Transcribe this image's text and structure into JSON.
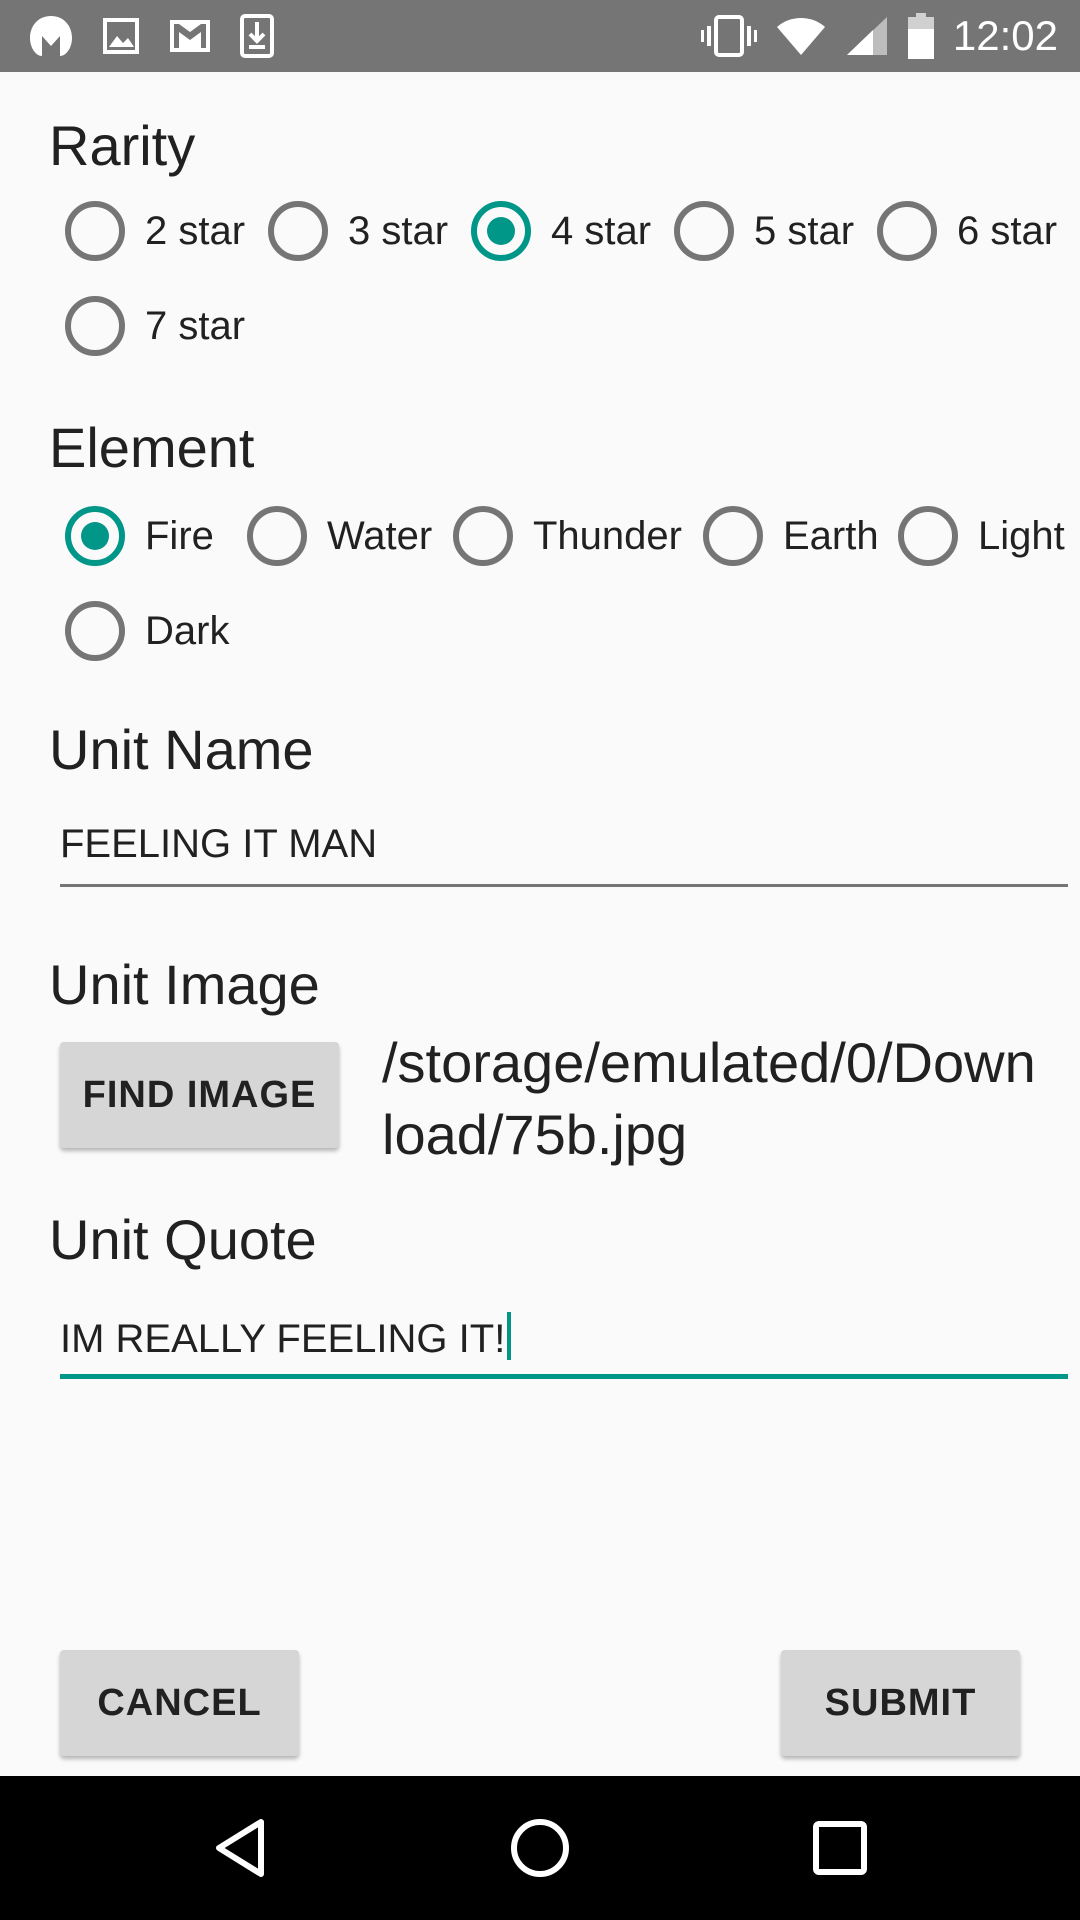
{
  "status_bar": {
    "left_icons": [
      "malwarebytes-icon",
      "image-icon",
      "gmail-icon",
      "download-icon"
    ],
    "right_icons": [
      "vibrate-icon",
      "wifi-icon",
      "signal-icon",
      "battery-icon"
    ],
    "time": "12:02"
  },
  "rarity": {
    "title": "Rarity",
    "options": [
      "2 star",
      "3 star",
      "4 star",
      "5 star",
      "6 star",
      "7 star"
    ],
    "selected": "4 star"
  },
  "element": {
    "title": "Element",
    "options": [
      "Fire",
      "Water",
      "Thunder",
      "Earth",
      "Light",
      "Dark"
    ],
    "selected": "Fire"
  },
  "unit_name": {
    "title": "Unit Name",
    "value": "FEELING IT MAN"
  },
  "unit_image": {
    "title": "Unit Image",
    "button_label": "FIND IMAGE",
    "path": "/storage/emulated/0/Download/75b.jpg"
  },
  "unit_quote": {
    "title": "Unit Quote",
    "value": "IM REALLY FEELING IT!"
  },
  "actions": {
    "cancel_label": "CANCEL",
    "submit_label": "SUBMIT"
  },
  "nav_bar": {
    "icons": [
      "back-icon",
      "home-icon",
      "recents-icon"
    ]
  },
  "colors": {
    "accent": "#009688",
    "status_bar": "#757575",
    "button": "#d6d6d6"
  }
}
